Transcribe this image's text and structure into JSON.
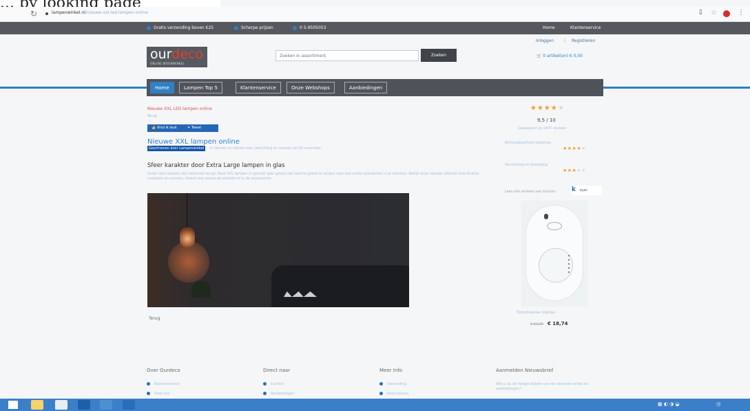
{
  "handwriting": "... by looking page",
  "browser": {
    "url_host": "lampenwinkel.nl",
    "url_rest": "/nieuwe-xxl-led-lampen-online",
    "reload_icon": "reload-icon",
    "star_icon": "bookmark-star-icon",
    "menu_icon": "more-vert-icon"
  },
  "topbar": {
    "usps": [
      "Gratis verzending boven €25",
      "Scherpe prijzen",
      "0 5-9505053"
    ],
    "links": [
      "Home",
      "Klantenservice"
    ]
  },
  "account": {
    "login": "Inloggen",
    "separator": "|",
    "register": "Registreren"
  },
  "logo": {
    "brand_main": "our",
    "brand_accent": "deco",
    "tagline": "ONLINE WOONWINKEL"
  },
  "search": {
    "placeholder": "Zoeken in assortiment",
    "button": "Zoeken"
  },
  "cart": {
    "label": "0 artikel(en) € 0,00"
  },
  "nav": {
    "tabs": [
      "Home",
      "Lampen Top 5",
      "Klantenservice",
      "Onze Webshops",
      "Aanbiedingen"
    ]
  },
  "article": {
    "breadcrumb": "Nieuwe XXL LED lampen online",
    "breadcrumb_sub": "Terug",
    "share_fb": "Vind ik leuk",
    "share_tw": "Tweet",
    "title": "Nieuwe XXL lampen online",
    "meta_highlight": "Geschreven door Lampenwinkel",
    "meta_rest": "in Nieuws en trends over verlichting en lampen op 29 november",
    "subheading": "Sfeer karakter door Extra Large lampen in glas",
    "paragraph": "Grote retro lampen zijn helemaal terug! Deze XXL lampen in gerookt glas geven een warme gloed en zorgen voor een echte eyecatcher in je interieur. Bekijk onze nieuwe collectie met diverse modellen en vormen, ideaal voor boven de eettafel of in de woonkamer.",
    "caption": "Terug"
  },
  "rating": {
    "stars_on": "★★★★",
    "stars_off": "★",
    "score": "9,5 / 10",
    "text": "Gebaseerd op 1467 reviews",
    "reviews": [
      {
        "label": "Betrouwbaarheid webshop",
        "stars_on": "★★★★",
        "stars_off": "★"
      },
      {
        "label": "Verzending en bezorging",
        "stars_on": "★★★",
        "stars_off": "★★"
      }
    ],
    "kiyoh_text": "Lees alle reviews van klanten",
    "kiyoh_logo": "k",
    "kiyoh_name": "kiyoh"
  },
  "product": {
    "name": "Tijdschakelaar digitaal",
    "old_price": "€ 22,95",
    "price": "€ 18,74"
  },
  "footer": {
    "columns": [
      {
        "heading": "Over Ourdeco",
        "items": [
          "Klantenservice",
          "Over ons"
        ]
      },
      {
        "heading": "Direct naar",
        "items": [
          "Contact",
          "Aanbiedingen"
        ]
      },
      {
        "heading": "Meer Info",
        "items": [
          "Verzending",
          "Retourneren"
        ]
      },
      {
        "heading": "Aanmelden Nieuwsbrief",
        "text": "Wilt u op de hoogte blijven van de nieuwste acties en aanbiedingen?"
      }
    ]
  },
  "colors": {
    "accent_blue": "#2f80c6",
    "nav_dark": "#50545a",
    "brand_red": "#e2412c",
    "star_gold": "#f0a020",
    "taskbar": "#3c7fc9"
  }
}
